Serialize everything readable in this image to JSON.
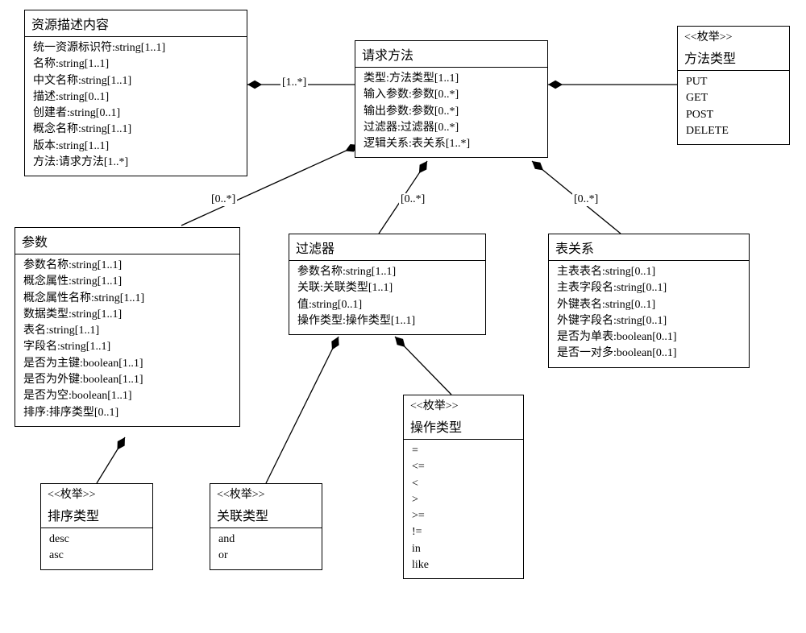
{
  "classes": {
    "resource": {
      "title": "资源描述内容",
      "attrs": [
        "统一资源标识符:string[1..1]",
        "名称:string[1..1]",
        "中文名称:string[1..1]",
        "描述:string[0..1]",
        "创建者:string[0..1]",
        "概念名称:string[1..1]",
        "版本:string[1..1]",
        "方法:请求方法[1..*]"
      ]
    },
    "request": {
      "title": "请求方法",
      "attrs": [
        "类型:方法类型[1..1]",
        "输入参数:参数[0..*]",
        "输出参数:参数[0..*]",
        "过滤器:过滤器[0..*]",
        "逻辑关系:表关系[1..*]"
      ]
    },
    "methodEnum": {
      "stereo": "<<枚举>>",
      "title": "方法类型",
      "attrs": [
        "PUT",
        "GET",
        "POST",
        "DELETE"
      ]
    },
    "param": {
      "title": "参数",
      "attrs": [
        "参数名称:string[1..1]",
        "概念属性:string[1..1]",
        "概念属性名称:string[1..1]",
        "数据类型:string[1..1]",
        "表名:string[1..1]",
        "字段名:string[1..1]",
        "是否为主键:boolean[1..1]",
        "是否为外键:boolean[1..1]",
        "是否为空:boolean[1..1]",
        "排序:排序类型[0..1]"
      ]
    },
    "filter": {
      "title": "过滤器",
      "attrs": [
        "参数名称:string[1..1]",
        "关联:关联类型[1..1]",
        "值:string[0..1]",
        "操作类型:操作类型[1..1]"
      ]
    },
    "tableRel": {
      "title": "表关系",
      "attrs": [
        "主表表名:string[0..1]",
        "主表字段名:string[0..1]",
        "外键表名:string[0..1]",
        "外键字段名:string[0..1]",
        "是否为单表:boolean[0..1]",
        "是否一对多:boolean[0..1]"
      ]
    },
    "sortEnum": {
      "stereo": "<<枚举>>",
      "title": "排序类型",
      "attrs": [
        "desc",
        "asc"
      ]
    },
    "relEnum": {
      "stereo": "<<枚举>>",
      "title": "关联类型",
      "attrs": [
        "and",
        "or"
      ]
    },
    "opEnum": {
      "stereo": "<<枚举>>",
      "title": "操作类型",
      "attrs": [
        "=",
        "<=",
        "<",
        ">",
        ">=",
        "!=",
        "in",
        "like"
      ]
    }
  },
  "labels": {
    "oneStar": "[1..*]",
    "zeroStar": "[0..*]"
  }
}
